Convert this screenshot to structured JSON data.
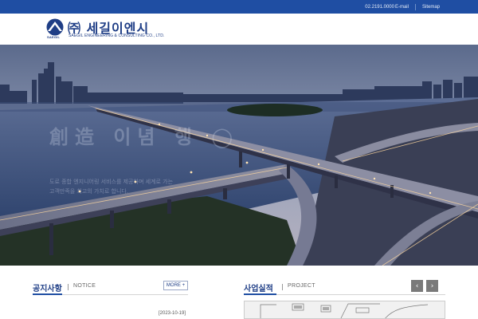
{
  "topbar": {
    "phone": "02.2191.0000",
    "email_label": "E-mail",
    "sitemap_label": "Sitemap"
  },
  "logo": {
    "name_ko": "㈜ 세길이엔시",
    "brand_short": "SAEGIL",
    "name_en": "SAEGIL  ENGINEERING & CONSULTING CO., LTD."
  },
  "hero": {
    "title": "創造 이념 행 ◯",
    "text_line1": "도로 종합 엔지니어링 서비스를 제공하며 세계로 가는",
    "text_line2": "고객만족을 최고의 가치로 합니다."
  },
  "notice": {
    "title": "공지사항",
    "subtitle": "NOTICE",
    "more_label": "MORE +",
    "first_date": "[2023-10-19]"
  },
  "project": {
    "title": "사업실적",
    "subtitle": "PROJECT",
    "prev_icon": "‹",
    "next_icon": "›"
  },
  "colors": {
    "brand": "#1f4ea3",
    "brand_dark": "#1f3e86"
  }
}
